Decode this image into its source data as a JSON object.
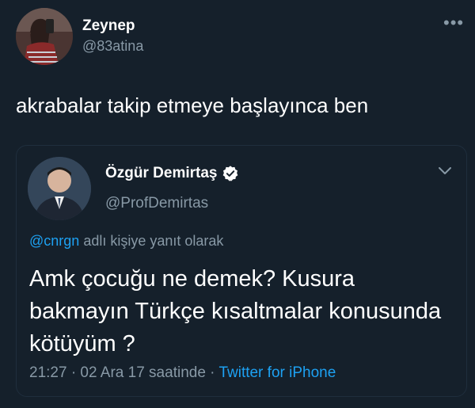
{
  "tweet": {
    "author": {
      "name": "Zeynep",
      "handle": "@83atina"
    },
    "more_icon": "more-dots-icon",
    "more_label": "•••",
    "text": "akrabalar takip etmeye başlayınca ben",
    "quoted": {
      "author": {
        "name": "Özgür Demirtaş",
        "handle": "@ProfDemirtas",
        "verified_icon": "verified-badge-icon"
      },
      "chevron_icon": "chevron-down-icon",
      "reply": {
        "mention": "@cnrgn",
        "suffix": " adlı kişiye yanıt olarak"
      },
      "text": "Amk çocuğu ne demek? Kusura bakmayın Türkçe kısaltmalar konusunda kötüyüm ?",
      "meta": {
        "time_date": "21:27 · 02 Ara 17 saatinde · ",
        "source": "Twitter for iPhone"
      }
    }
  },
  "colors": {
    "background": "#15202b",
    "text_primary": "#ffffff",
    "text_secondary": "#8899a6",
    "accent": "#1da1f2",
    "border": "#1f2e3d"
  }
}
